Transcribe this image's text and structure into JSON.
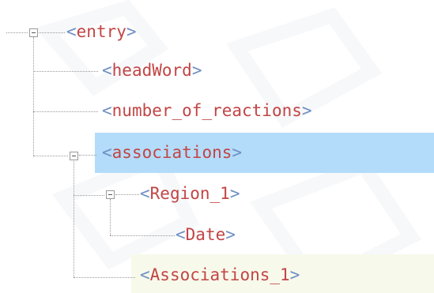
{
  "colors": {
    "tag_text": "#c24545",
    "bracket": "#6e8ec4",
    "selected_bg": "#b3dcfa",
    "hover_bg": "#f7faeb",
    "connector": "#9a9a9a"
  },
  "tree": {
    "entry": {
      "label": "entry",
      "expanded": true
    },
    "headWord": {
      "label": "headWord"
    },
    "number_of_reactions": {
      "label": "number_of_reactions"
    },
    "associations": {
      "label": "associations",
      "expanded": true,
      "selected": true
    },
    "region_1": {
      "label": "Region_1",
      "expanded": true
    },
    "date": {
      "label": "Date"
    },
    "associations_1": {
      "label": "Associations_1",
      "hovered": true
    }
  }
}
